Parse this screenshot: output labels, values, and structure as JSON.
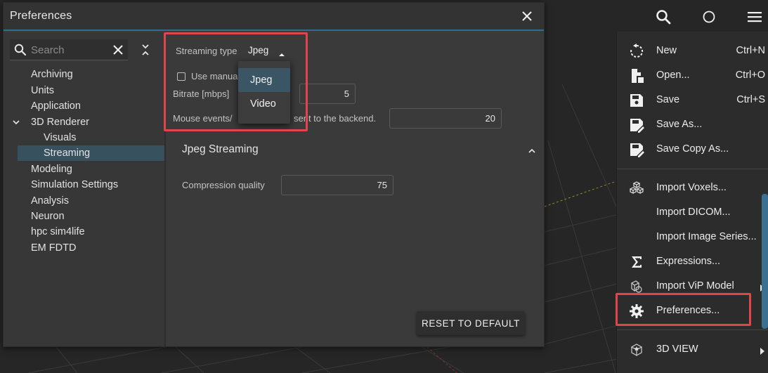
{
  "dialog": {
    "title": "Preferences",
    "search_placeholder": "Search"
  },
  "tree": {
    "items": [
      {
        "label": "Archiving"
      },
      {
        "label": "Units"
      },
      {
        "label": "Application"
      },
      {
        "label": "3D Renderer"
      },
      {
        "label": "Visuals"
      },
      {
        "label": "Streaming"
      },
      {
        "label": "Modeling"
      },
      {
        "label": "Simulation Settings"
      },
      {
        "label": "Analysis"
      },
      {
        "label": "Neuron"
      },
      {
        "label": "hpc sim4life"
      },
      {
        "label": "EM FDTD"
      }
    ],
    "selected": "Streaming"
  },
  "content": {
    "streaming_type_label": "Streaming type",
    "streaming_type_value": "Jpeg",
    "use_manual_label": "Use manual",
    "bitrate_label": "Bitrate [mbps]",
    "bitrate_value": "5",
    "mouse_events_label_left": "Mouse events/",
    "mouse_events_label_right": "sent to the backend.",
    "mouse_events_value": "20",
    "section_title": "Jpeg Streaming",
    "compression_label": "Compression quality",
    "compression_value": "75",
    "reset_button": "RESET TO DEFAULT"
  },
  "dropdown": {
    "options": [
      {
        "label": "Jpeg",
        "active": true
      },
      {
        "label": "Video",
        "active": false
      }
    ]
  },
  "side_menu": {
    "items": [
      {
        "label": "New",
        "shortcut": "Ctrl+N",
        "icon": "new-icon"
      },
      {
        "label": "Open...",
        "shortcut": "Ctrl+O",
        "icon": "open-file-icon"
      },
      {
        "label": "Save",
        "shortcut": "Ctrl+S",
        "icon": "save-icon"
      },
      {
        "label": "Save As...",
        "shortcut": "",
        "icon": "save-as-icon"
      },
      {
        "label": "Save Copy As...",
        "shortcut": "",
        "icon": "save-copy-icon"
      },
      {
        "label": "Import Voxels...",
        "shortcut": "",
        "icon": "voxels-icon"
      },
      {
        "label": "Import DICOM...",
        "shortcut": "",
        "icon": ""
      },
      {
        "label": "Import Image Series...",
        "shortcut": "",
        "icon": ""
      },
      {
        "label": "Expressions...",
        "shortcut": "",
        "icon": "sigma-icon"
      },
      {
        "label": "Import ViP Model",
        "shortcut": "",
        "icon": "vip-model-icon"
      },
      {
        "label": "Preferences...",
        "shortcut": "",
        "icon": "gear-icon"
      },
      {
        "label": "3D VIEW",
        "shortcut": "",
        "icon": "3d-view-icon"
      }
    ]
  },
  "colors": {
    "accent": "#2f6e8c",
    "highlight": "#e0454c",
    "selection": "#38515e"
  }
}
